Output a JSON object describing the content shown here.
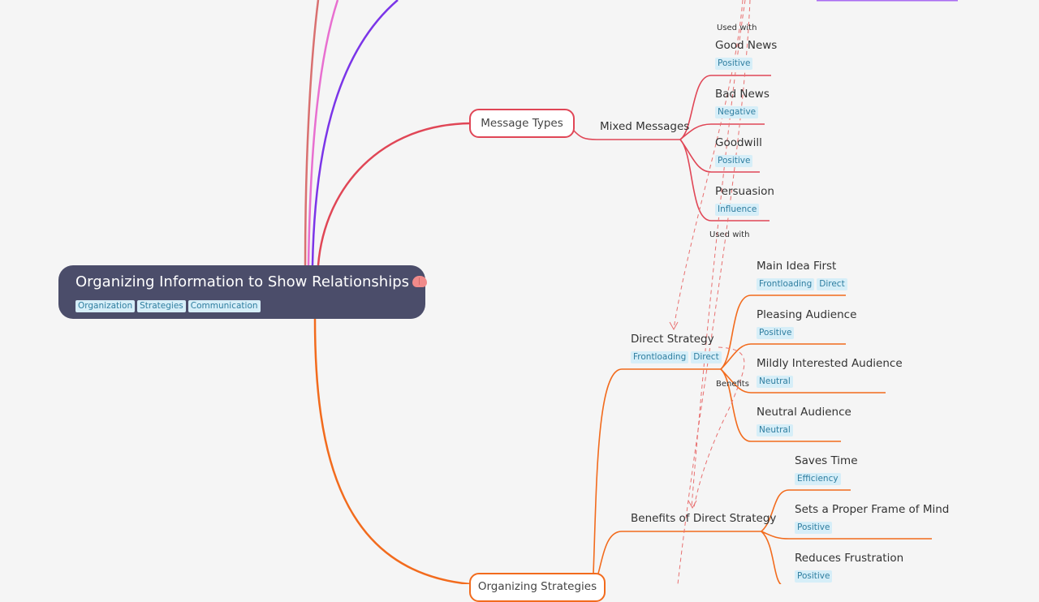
{
  "root": {
    "title": "Organizing Information to Show Relationships",
    "icon": "brain-emoji",
    "tags": [
      "Organization",
      "Strategies",
      "Communication"
    ]
  },
  "colors": {
    "background": "#f5f5f5",
    "root_fill": "#4b4d6a",
    "message_branch": "#e04656",
    "strategy_branch": "#f26b1d",
    "purple_branch": "#7b35e8",
    "pink_branch": "#e86fd0",
    "salmon_branch": "#d97070",
    "tag_fill": "#d6eef8",
    "tag_text": "#2f7ea0"
  },
  "message_types": {
    "label": "Message Types",
    "child": {
      "label": "Mixed Messages",
      "children": [
        {
          "label": "Good News",
          "tags": [
            "Positive"
          ]
        },
        {
          "label": "Bad News",
          "tags": [
            "Negative"
          ]
        },
        {
          "label": "Goodwill",
          "tags": [
            "Positive"
          ]
        },
        {
          "label": "Persuasion",
          "tags": [
            "Influence"
          ]
        }
      ]
    }
  },
  "organizing_strategies": {
    "label": "Organizing Strategies",
    "children": [
      {
        "label": "Direct Strategy",
        "tags": [
          "Frontloading",
          "Direct"
        ],
        "children": [
          {
            "label": "Main Idea First",
            "tags": [
              "Frontloading",
              "Direct"
            ]
          },
          {
            "label": "Pleasing Audience",
            "tags": [
              "Positive"
            ]
          },
          {
            "label": "Mildly Interested Audience",
            "tags": [
              "Neutral"
            ]
          },
          {
            "label": "Neutral Audience",
            "tags": [
              "Neutral"
            ]
          }
        ]
      },
      {
        "label": "Benefits of Direct Strategy",
        "children": [
          {
            "label": "Saves Time",
            "tags": [
              "Efficiency"
            ]
          },
          {
            "label": "Sets a Proper Frame of Mind",
            "tags": [
              "Positive"
            ]
          },
          {
            "label": "Reduces Frustration",
            "tags": [
              "Positive"
            ]
          }
        ]
      }
    ]
  },
  "relationship_labels": {
    "used_with_top": "Used with",
    "used_with_bottom": "Used with",
    "benefits": "Benefits"
  }
}
